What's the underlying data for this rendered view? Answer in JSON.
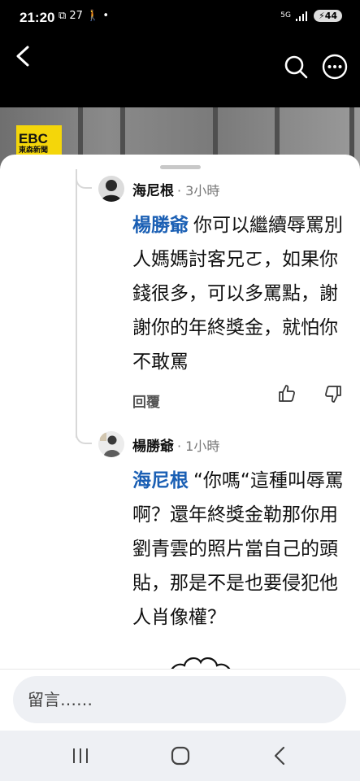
{
  "status_bar": {
    "time": "21:20",
    "left_icons": "⧉ 27 🚶 •",
    "network": "5G",
    "battery": "44"
  },
  "header": {
    "back_icon": "chevron-left-icon",
    "search_icon": "search-icon",
    "more_icon": "more-horizontal-icon"
  },
  "background": {
    "logo_text": "EBC",
    "logo_sub": "東森新聞"
  },
  "comments": [
    {
      "author": "海尼根",
      "time": "· 3小時",
      "mention": "楊勝爺",
      "text": "你可以繼續辱罵別人媽媽討客兄ㄛ，如果你錢很多，可以多罵點，謝謝你的年終獎金，就怕你不敢罵",
      "reply_label": "回覆"
    },
    {
      "author": "楊勝爺",
      "time": "· 1小時",
      "mention": "海尼根",
      "text": "“你嗎“這種叫辱罵啊？還年終獎金勒那你用劉青雲的照片當自己的頭貼，那是不是也要侵犯他人肖像權？"
    }
  ],
  "input": {
    "placeholder": "留言……"
  },
  "nav": {
    "recent_icon": "recent-apps-icon",
    "home_icon": "home-icon",
    "back_icon": "back-icon"
  },
  "colors": {
    "mention": "#1a5fb4",
    "status_bg": "#000000",
    "sheet_bg": "#ffffff",
    "nav_bg": "#eef0f4"
  }
}
